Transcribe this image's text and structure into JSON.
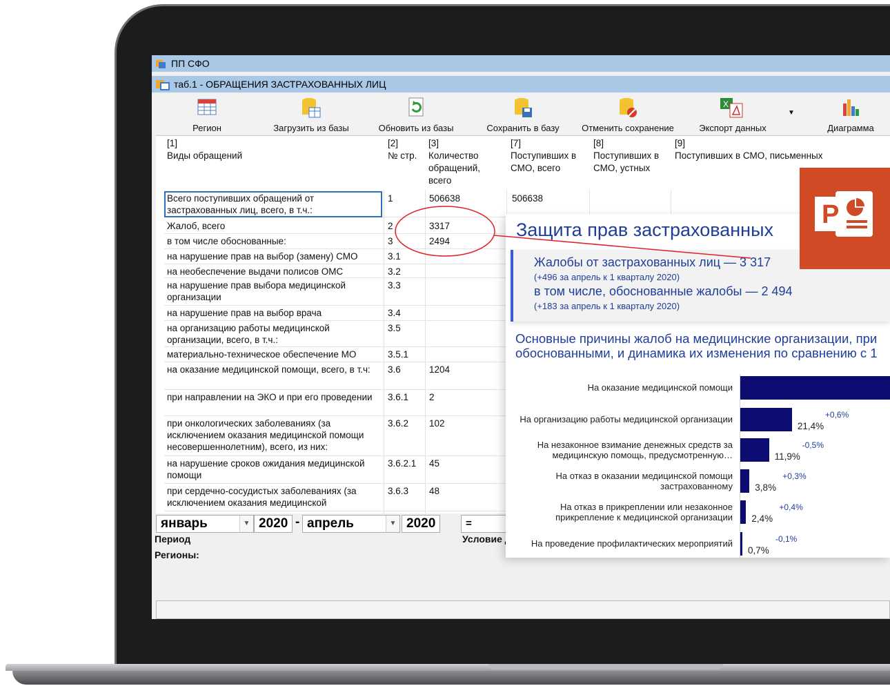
{
  "app": {
    "title": "ПП СФО",
    "subtitle": "таб.1 - ОБРАЩЕНИЯ ЗАСТРАХОВАННЫХ ЛИЦ"
  },
  "toolbar": {
    "region": "Регион",
    "load": "Загрузить из базы",
    "refresh": "Обновить из базы",
    "save": "Сохранить в базу",
    "cancel": "Отменить сохранение",
    "export": "Экспорт данных",
    "chart": "Диаграмма"
  },
  "columns": {
    "c1_num": "[1]",
    "c1_title": "Виды обращений",
    "c2_num": "[2]",
    "c2_title": "№ стр.",
    "c3_num": "[3]",
    "c3_title": "Количество обращений, всего",
    "c7_num": "[7]",
    "c7_title": "Поступивших в СМО, всего",
    "c8_num": "[8]",
    "c8_title": "Поступивших в СМО, устных",
    "c9_num": "[9]",
    "c9_title": "Поступивших в СМО, письменных"
  },
  "rows": [
    {
      "name": "Всего поступивших обращений от застрахованных лиц, всего, в т.ч.:",
      "line": "1",
      "total": "506638",
      "smo": "506638"
    },
    {
      "name": "Жалоб, всего",
      "line": "2",
      "total": "3317",
      "smo": ""
    },
    {
      "name": "в том числе обоснованные:",
      "line": "3",
      "total": "2494",
      "smo": ""
    },
    {
      "name": "на нарушение прав на выбор (замену) СМО",
      "line": "3.1",
      "total": "",
      "smo": ""
    },
    {
      "name": "на необеспечение выдачи полисов ОМС",
      "line": "3.2",
      "total": "",
      "smo": ""
    },
    {
      "name": "на нарушение прав выбора медицинской организации",
      "line": "3.3",
      "total": "",
      "smo": ""
    },
    {
      "name": "на нарушение прав на выбор врача",
      "line": "3.4",
      "total": "",
      "smo": ""
    },
    {
      "name": "на организацию работы медицинской организации, всего, в т.ч.:",
      "line": "3.5",
      "total": "",
      "smo": ""
    },
    {
      "name": "материально-техническое обеспечение МО",
      "line": "3.5.1",
      "total": "",
      "smo": ""
    },
    {
      "name": "на оказание медицинской помощи, всего, в т.ч:",
      "line": "3.6",
      "total": "1204",
      "smo": ""
    },
    {
      "name": "при направлении на ЭКО и при его проведении",
      "line": "3.6.1",
      "total": "2",
      "smo": ""
    },
    {
      "name": "при онкологических заболеваниях (за исключением оказания медицинской помощи несовершеннолетним), всего, из них:",
      "line": "3.6.2",
      "total": "102",
      "smo": ""
    },
    {
      "name": "на нарушение сроков ожидания медицинской помощи",
      "line": "3.6.2.1",
      "total": "45",
      "smo": ""
    },
    {
      "name": "при сердечно-сосудистых заболеваниях (за исключением оказания медицинской",
      "line": "3.6.3",
      "total": "48",
      "smo": ""
    }
  ],
  "period": {
    "from_month": "январь",
    "from_year": "2020",
    "dash": "-",
    "to_month": "апрель",
    "to_year": "2020",
    "eq": "=",
    "period_label": "Период",
    "condition_label": "Условие д",
    "regions_label": "Регионы:"
  },
  "slide": {
    "title": "Защита прав застрахованных",
    "complaints": "Жалобы от застрахованных лиц — 3 317",
    "complaints_delta": "(+496 за апрель к 1 кварталу 2020)",
    "justified": "в том числе, обоснованные жалобы — 2 494",
    "justified_delta": "(+183 за апрель к 1 кварталу 2020)",
    "reasons_line1": "Основные причины жалоб на медицинские организации, при",
    "reasons_line2": "обоснованными, и динамика их изменения по сравнению с 1"
  },
  "chart_data": {
    "type": "bar",
    "orientation": "horizontal",
    "categories": [
      "На оказание медицинской помощи",
      "На организацию работы медицинской организации",
      "На незаконное взимание денежных средств за медицинскую помощь, предусмотренную…",
      "На отказ в оказании медицинской помощи застрахованному",
      "На отказ в прикреплении или незаконное прикрепление к медицинской организации",
      "На проведение профилактических мероприятий"
    ],
    "value_labels": [
      "",
      "21,4%",
      "11,9%",
      "3,8%",
      "2,4%",
      "0,7%"
    ],
    "values": [
      62,
      21.4,
      11.9,
      3.8,
      2.4,
      0.7
    ],
    "delta_labels": [
      "",
      "+0,6%",
      "-0,5%",
      "+0,3%",
      "+0,4%",
      "-0,1%"
    ],
    "bar_color": "#0c0c73"
  },
  "colors": {
    "titlebar": "#a9c8e6",
    "accent": "#1f3d99",
    "annotation": "#e0202a",
    "ppt": "#cf4a25"
  }
}
